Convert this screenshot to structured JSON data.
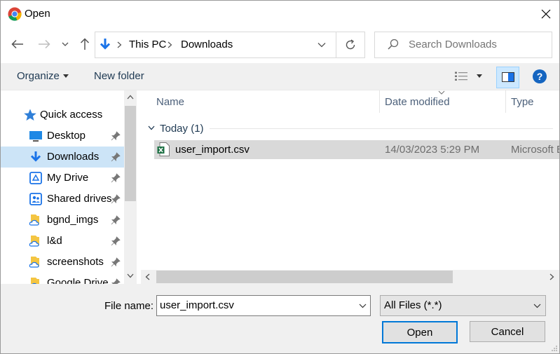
{
  "window": {
    "title": "Open"
  },
  "breadcrumb": {
    "items": [
      "This PC",
      "Downloads"
    ]
  },
  "search": {
    "placeholder": "Search Downloads"
  },
  "toolbar": {
    "organize": "Organize",
    "new_folder": "New folder"
  },
  "sidebar": {
    "quick_access": "Quick access",
    "items": [
      {
        "label": "Desktop",
        "icon": "desktop-icon"
      },
      {
        "label": "Downloads",
        "icon": "download-arrow-icon",
        "selected": true
      },
      {
        "label": "My Drive",
        "icon": "drive-icon"
      },
      {
        "label": "Shared drives",
        "icon": "shared-drive-icon"
      },
      {
        "label": "bgnd_imgs",
        "icon": "cloud-folder-icon"
      },
      {
        "label": "l&d",
        "icon": "cloud-folder-icon"
      },
      {
        "label": "screenshots",
        "icon": "cloud-folder-icon"
      },
      {
        "label": "Google Drive",
        "icon": "cloud-folder-icon"
      }
    ]
  },
  "columns": {
    "name": "Name",
    "date": "Date modified",
    "type": "Type"
  },
  "group": {
    "label": "Today (1)"
  },
  "files": [
    {
      "name": "user_import.csv",
      "date": "14/03/2023 5:29 PM",
      "type": "Microsoft Excel Comma Separated Values File",
      "icon": "excel-csv-icon"
    }
  ],
  "footer": {
    "filename_label": "File name:",
    "filename_value": "user_import.csv",
    "filetype": "All Files (*.*)",
    "open": "Open",
    "cancel": "Cancel"
  },
  "colors": {
    "accent": "#0078d7",
    "selection": "#cce4f7",
    "file_selection": "#d9d9d9"
  }
}
